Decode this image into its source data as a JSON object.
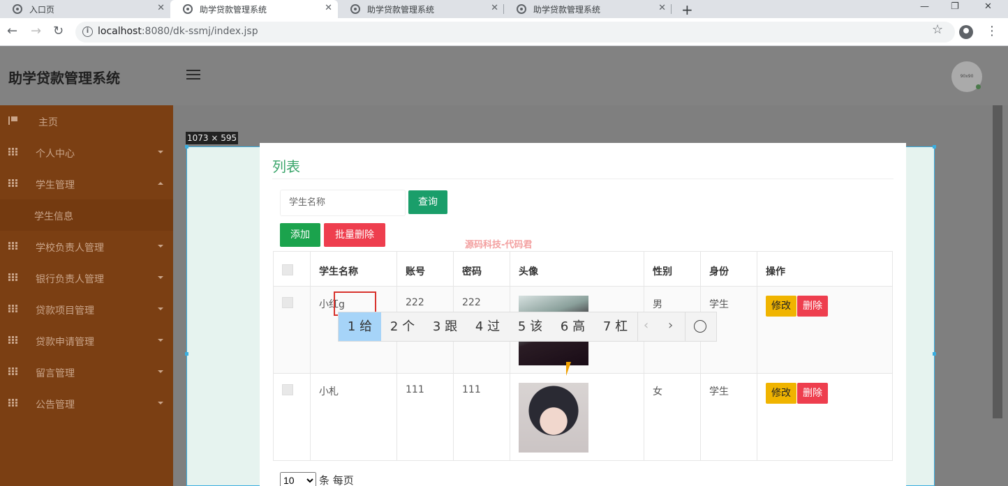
{
  "browser": {
    "tabs": [
      {
        "label": "入口页"
      },
      {
        "label": "助学贷款管理系统"
      },
      {
        "label": "助学贷款管理系统"
      },
      {
        "label": "助学贷款管理系统"
      }
    ],
    "url": "localhost:8080/dk-ssmj/index.jsp",
    "url_host_part": "localhost",
    "url_path_part": ":8080/dk-ssmj/index.jsp"
  },
  "app": {
    "title": "助学贷款管理系统",
    "avatar_text": "90x90"
  },
  "sidebar": {
    "items": [
      {
        "label": "主页"
      },
      {
        "label": "个人中心"
      },
      {
        "label": "学生管理"
      },
      {
        "label": "学生信息"
      },
      {
        "label": "学校负责人管理"
      },
      {
        "label": "银行负责人管理"
      },
      {
        "label": "贷款项目管理"
      },
      {
        "label": "贷款申请管理"
      },
      {
        "label": "留言管理"
      },
      {
        "label": "公告管理"
      }
    ]
  },
  "overlay": {
    "dimensions": "1073 × 595"
  },
  "panel": {
    "title": "列表",
    "search_placeholder": "学生名称",
    "search_button": "查询",
    "add_button": "添加",
    "batch_delete_button": "批量删除",
    "watermark": "源码科技-代码君"
  },
  "table": {
    "headers": [
      "学生名称",
      "账号",
      "密码",
      "头像",
      "性别",
      "身份",
      "操作"
    ],
    "rows": [
      {
        "name": "小红g",
        "account": "222",
        "password": "222",
        "gender": "男",
        "role": "学生"
      },
      {
        "name": "小札",
        "account": "111",
        "password": "111",
        "gender": "女",
        "role": "学生"
      }
    ],
    "edit_label": "修改",
    "delete_label": "删除"
  },
  "pager": {
    "page_size": "10",
    "suffix": "条 每页"
  },
  "ime": {
    "candidates": [
      {
        "num": "1",
        "char": "给"
      },
      {
        "num": "2",
        "char": "个"
      },
      {
        "num": "3",
        "char": "跟"
      },
      {
        "num": "4",
        "char": "过"
      },
      {
        "num": "5",
        "char": "该"
      },
      {
        "num": "6",
        "char": "高"
      },
      {
        "num": "7",
        "char": "杠"
      }
    ]
  }
}
